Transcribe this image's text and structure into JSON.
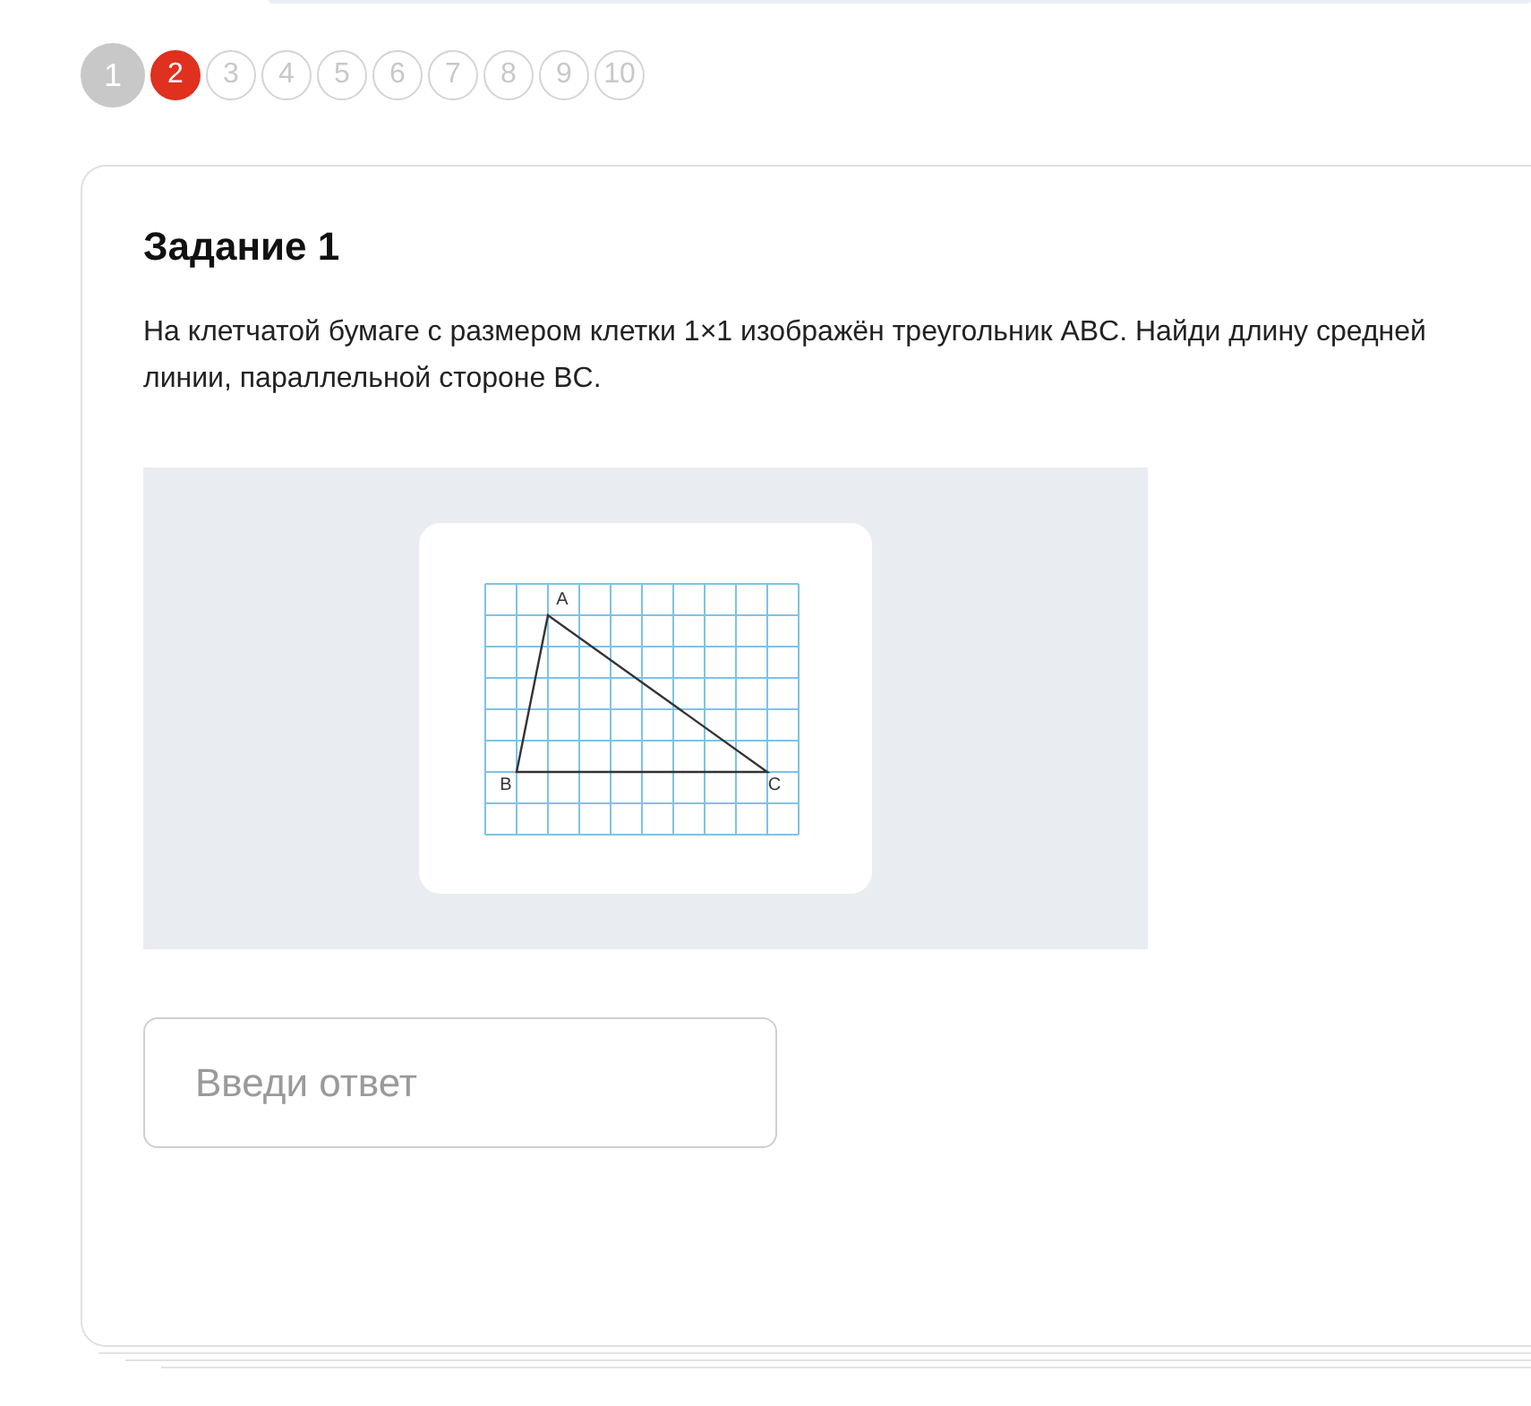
{
  "steps": [
    {
      "label": "1",
      "visited": true,
      "selected": false
    },
    {
      "label": "2",
      "visited": false,
      "selected": true
    },
    {
      "label": "3",
      "visited": false,
      "selected": false
    },
    {
      "label": "4",
      "visited": false,
      "selected": false
    },
    {
      "label": "5",
      "visited": false,
      "selected": false
    },
    {
      "label": "6",
      "visited": false,
      "selected": false
    },
    {
      "label": "7",
      "visited": false,
      "selected": false
    },
    {
      "label": "8",
      "visited": false,
      "selected": false
    },
    {
      "label": "9",
      "visited": false,
      "selected": false
    },
    {
      "label": "10",
      "visited": false,
      "selected": false
    }
  ],
  "task": {
    "title": "Задание 1",
    "text": "На клетчатой бумаге с размером клетки 1×1 изображён треугольник ABC. Найди длину средней линии, параллельной стороне BC.",
    "figure": {
      "vertex_labels": [
        "A",
        "B",
        "C"
      ]
    },
    "answer": {
      "placeholder": "Введи ответ"
    }
  }
}
